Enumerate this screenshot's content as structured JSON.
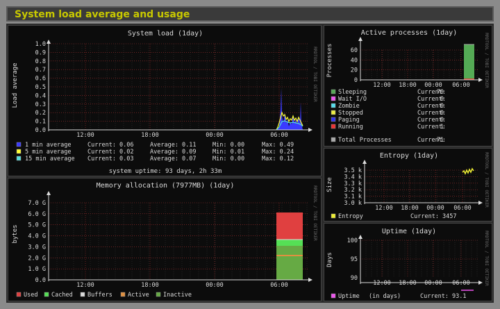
{
  "page_title": "System load average and usage",
  "watermark": "RRDTOOL / TOBI OETIKER",
  "load": {
    "title": "System load   (1day)",
    "ylabel": "Load average",
    "yticks": [
      "1.0",
      "0.9",
      "0.8",
      "0.7",
      "0.6",
      "0.5",
      "0.4",
      "0.3",
      "0.2",
      "0.1",
      "0.0"
    ],
    "xticks": [
      "12:00",
      "18:00",
      "00:00",
      "06:00"
    ],
    "legend": [
      {
        "name": "1 min average",
        "current": "Current: 0.06",
        "average": "Average: 0.11",
        "min": "Min: 0.00",
        "max": "Max: 0.49",
        "color": "#3a3aff"
      },
      {
        "name": "5 min average",
        "current": "Current: 0.02",
        "average": "Average: 0.09",
        "min": "Min: 0.01",
        "max": "Max: 0.24",
        "color": "#ffff33"
      },
      {
        "name": "15 min average",
        "current": "Current: 0.03",
        "average": "Average: 0.07",
        "min": "Min: 0.00",
        "max": "Max: 0.12",
        "color": "#55dddd"
      }
    ],
    "uptime": "system uptime: 93 days, 2h 33m"
  },
  "memory": {
    "title": "Memory allocation (7977MB)   (1day)",
    "ylabel": "bytes",
    "yticks": [
      "7.0 G",
      "6.0 G",
      "5.0 G",
      "4.0 G",
      "3.0 G",
      "2.0 G",
      "1.0 G",
      "0.0"
    ],
    "xticks": [
      "12:00",
      "18:00",
      "00:00",
      "06:00"
    ],
    "legend": [
      {
        "name": "Used",
        "color": "#e04040"
      },
      {
        "name": "Cached",
        "color": "#55e055"
      },
      {
        "name": "Buffers",
        "color": "#dddddd"
      },
      {
        "name": "Active",
        "color": "#e09040"
      },
      {
        "name": "Inactive",
        "color": "#66aa44"
      }
    ]
  },
  "processes": {
    "title": "Active processes   (1day)",
    "ylabel": "Processes",
    "yticks": [
      "60",
      "40",
      "20",
      "0"
    ],
    "xticks": [
      "12:00",
      "18:00",
      "00:00",
      "06:00"
    ],
    "legend": [
      {
        "name": "Sleeping",
        "current": "Current:",
        "value": "70",
        "color": "#55aa55"
      },
      {
        "name": "Wait I/O",
        "current": "Current:",
        "value": "0",
        "color": "#ee55ee"
      },
      {
        "name": "Zombie",
        "current": "Current:",
        "value": "0",
        "color": "#55ddee"
      },
      {
        "name": "Stopped",
        "current": "Current:",
        "value": "0",
        "color": "#eeee44"
      },
      {
        "name": "Paging",
        "current": "Current:",
        "value": "0",
        "color": "#3333ee"
      },
      {
        "name": "Running",
        "current": "Current:",
        "value": "1",
        "color": "#ee3333"
      }
    ],
    "total": {
      "name": "Total Processes",
      "current": "Current:",
      "value": "71",
      "color": "#aaaaaa"
    }
  },
  "entropy": {
    "title": "Entropy   (1day)",
    "ylabel": "Size",
    "yticks": [
      "3.5 k",
      "3.4 k",
      "3.3 k",
      "3.2 k",
      "3.1 k",
      "3.0 k"
    ],
    "xticks": [
      "12:00",
      "18:00",
      "00:00",
      "06:00"
    ],
    "legend": {
      "name": "Entropy",
      "current": "Current: 3457",
      "color": "#eeee33"
    }
  },
  "uptime_graph": {
    "title": "Uptime   (1day)",
    "ylabel": "Days",
    "yticks": [
      "100",
      "95",
      "90"
    ],
    "xticks": [
      "12:00",
      "18:00",
      "00:00",
      "06:00"
    ],
    "legend": {
      "name": "Uptime",
      "unit": "(in days)",
      "current": "Current: 93.1",
      "color": "#ee55ee"
    }
  }
}
